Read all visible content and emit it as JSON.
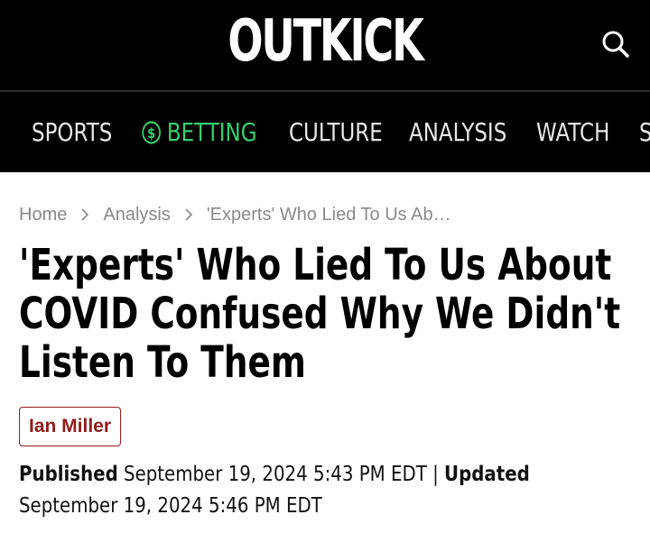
{
  "header": {
    "logo_text": "OUTKICK",
    "search_icon": "search-icon"
  },
  "nav": {
    "items": [
      {
        "label": "SPORTS"
      },
      {
        "label": "BETTING",
        "icon": "dollar-circle-icon",
        "color": "#35d06f"
      },
      {
        "label": "CULTURE"
      },
      {
        "label": "ANALYSIS"
      },
      {
        "label": "WATCH"
      },
      {
        "label": "S"
      }
    ]
  },
  "breadcrumb": {
    "items": [
      "Home",
      "Analysis",
      "'Experts' Who Lied To Us Ab…"
    ]
  },
  "article": {
    "title": "'Experts' Who Lied To Us About COVID Confused Why We Didn't Listen To Them",
    "author": "Ian Miller",
    "published_label": "Published",
    "published_date": "September 19, 2024 5:43 PM EDT",
    "separator": "|",
    "updated_label": "Updated",
    "updated_date": "September 19, 2024 5:46 PM EDT"
  },
  "colors": {
    "background": "#000000",
    "betting_accent": "#35d06f",
    "author_accent": "#8e1d1d"
  }
}
